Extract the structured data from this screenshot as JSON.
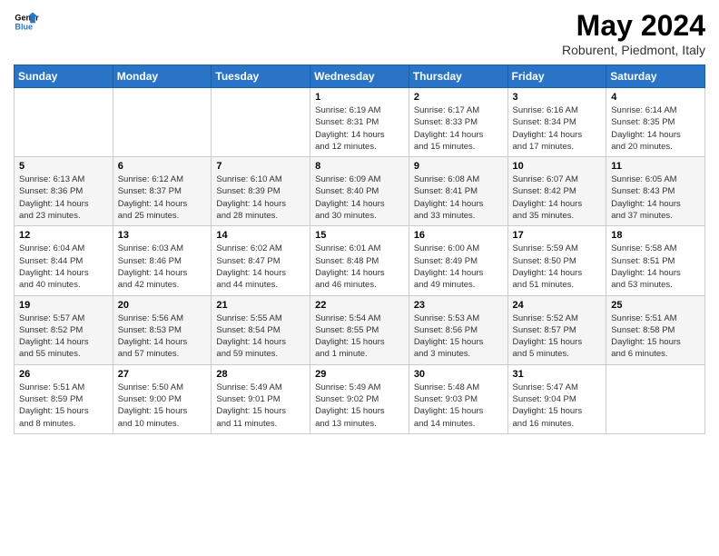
{
  "header": {
    "logo_line1": "General",
    "logo_line2": "Blue",
    "month_year": "May 2024",
    "location": "Roburent, Piedmont, Italy"
  },
  "days_of_week": [
    "Sunday",
    "Monday",
    "Tuesday",
    "Wednesday",
    "Thursday",
    "Friday",
    "Saturday"
  ],
  "weeks": [
    [
      {
        "day": "",
        "info": ""
      },
      {
        "day": "",
        "info": ""
      },
      {
        "day": "",
        "info": ""
      },
      {
        "day": "1",
        "info": "Sunrise: 6:19 AM\nSunset: 8:31 PM\nDaylight: 14 hours\nand 12 minutes."
      },
      {
        "day": "2",
        "info": "Sunrise: 6:17 AM\nSunset: 8:33 PM\nDaylight: 14 hours\nand 15 minutes."
      },
      {
        "day": "3",
        "info": "Sunrise: 6:16 AM\nSunset: 8:34 PM\nDaylight: 14 hours\nand 17 minutes."
      },
      {
        "day": "4",
        "info": "Sunrise: 6:14 AM\nSunset: 8:35 PM\nDaylight: 14 hours\nand 20 minutes."
      }
    ],
    [
      {
        "day": "5",
        "info": "Sunrise: 6:13 AM\nSunset: 8:36 PM\nDaylight: 14 hours\nand 23 minutes."
      },
      {
        "day": "6",
        "info": "Sunrise: 6:12 AM\nSunset: 8:37 PM\nDaylight: 14 hours\nand 25 minutes."
      },
      {
        "day": "7",
        "info": "Sunrise: 6:10 AM\nSunset: 8:39 PM\nDaylight: 14 hours\nand 28 minutes."
      },
      {
        "day": "8",
        "info": "Sunrise: 6:09 AM\nSunset: 8:40 PM\nDaylight: 14 hours\nand 30 minutes."
      },
      {
        "day": "9",
        "info": "Sunrise: 6:08 AM\nSunset: 8:41 PM\nDaylight: 14 hours\nand 33 minutes."
      },
      {
        "day": "10",
        "info": "Sunrise: 6:07 AM\nSunset: 8:42 PM\nDaylight: 14 hours\nand 35 minutes."
      },
      {
        "day": "11",
        "info": "Sunrise: 6:05 AM\nSunset: 8:43 PM\nDaylight: 14 hours\nand 37 minutes."
      }
    ],
    [
      {
        "day": "12",
        "info": "Sunrise: 6:04 AM\nSunset: 8:44 PM\nDaylight: 14 hours\nand 40 minutes."
      },
      {
        "day": "13",
        "info": "Sunrise: 6:03 AM\nSunset: 8:46 PM\nDaylight: 14 hours\nand 42 minutes."
      },
      {
        "day": "14",
        "info": "Sunrise: 6:02 AM\nSunset: 8:47 PM\nDaylight: 14 hours\nand 44 minutes."
      },
      {
        "day": "15",
        "info": "Sunrise: 6:01 AM\nSunset: 8:48 PM\nDaylight: 14 hours\nand 46 minutes."
      },
      {
        "day": "16",
        "info": "Sunrise: 6:00 AM\nSunset: 8:49 PM\nDaylight: 14 hours\nand 49 minutes."
      },
      {
        "day": "17",
        "info": "Sunrise: 5:59 AM\nSunset: 8:50 PM\nDaylight: 14 hours\nand 51 minutes."
      },
      {
        "day": "18",
        "info": "Sunrise: 5:58 AM\nSunset: 8:51 PM\nDaylight: 14 hours\nand 53 minutes."
      }
    ],
    [
      {
        "day": "19",
        "info": "Sunrise: 5:57 AM\nSunset: 8:52 PM\nDaylight: 14 hours\nand 55 minutes."
      },
      {
        "day": "20",
        "info": "Sunrise: 5:56 AM\nSunset: 8:53 PM\nDaylight: 14 hours\nand 57 minutes."
      },
      {
        "day": "21",
        "info": "Sunrise: 5:55 AM\nSunset: 8:54 PM\nDaylight: 14 hours\nand 59 minutes."
      },
      {
        "day": "22",
        "info": "Sunrise: 5:54 AM\nSunset: 8:55 PM\nDaylight: 15 hours\nand 1 minute."
      },
      {
        "day": "23",
        "info": "Sunrise: 5:53 AM\nSunset: 8:56 PM\nDaylight: 15 hours\nand 3 minutes."
      },
      {
        "day": "24",
        "info": "Sunrise: 5:52 AM\nSunset: 8:57 PM\nDaylight: 15 hours\nand 5 minutes."
      },
      {
        "day": "25",
        "info": "Sunrise: 5:51 AM\nSunset: 8:58 PM\nDaylight: 15 hours\nand 6 minutes."
      }
    ],
    [
      {
        "day": "26",
        "info": "Sunrise: 5:51 AM\nSunset: 8:59 PM\nDaylight: 15 hours\nand 8 minutes."
      },
      {
        "day": "27",
        "info": "Sunrise: 5:50 AM\nSunset: 9:00 PM\nDaylight: 15 hours\nand 10 minutes."
      },
      {
        "day": "28",
        "info": "Sunrise: 5:49 AM\nSunset: 9:01 PM\nDaylight: 15 hours\nand 11 minutes."
      },
      {
        "day": "29",
        "info": "Sunrise: 5:49 AM\nSunset: 9:02 PM\nDaylight: 15 hours\nand 13 minutes."
      },
      {
        "day": "30",
        "info": "Sunrise: 5:48 AM\nSunset: 9:03 PM\nDaylight: 15 hours\nand 14 minutes."
      },
      {
        "day": "31",
        "info": "Sunrise: 5:47 AM\nSunset: 9:04 PM\nDaylight: 15 hours\nand 16 minutes."
      },
      {
        "day": "",
        "info": ""
      }
    ]
  ]
}
